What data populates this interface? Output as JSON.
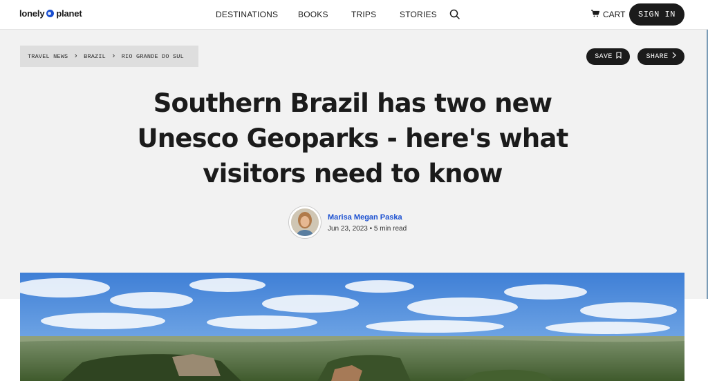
{
  "header": {
    "logo": {
      "left": "lonely",
      "right": "planet"
    },
    "nav": [
      "DESTINATIONS",
      "BOOKS",
      "TRIPS",
      "STORIES"
    ],
    "cart_label": "CART",
    "signin_label": "SIGN IN"
  },
  "breadcrumb": [
    "TRAVEL NEWS",
    "BRAZIL",
    "RIO GRANDE DO SUL"
  ],
  "actions": {
    "save_label": "SAVE",
    "share_label": "SHARE"
  },
  "article": {
    "title_lines": [
      "Southern Brazil has two new",
      "Unesco Geoparks - here's what",
      "visitors need to know"
    ],
    "author": "Marisa Megan Paska",
    "meta": "Jun 23, 2023 • 5 min read"
  },
  "colors": {
    "accent_link": "#1a4fd0",
    "dark_button": "#1b1b1b",
    "page_bg": "#f2f2f2"
  },
  "icons": [
    "globe-icon",
    "search-icon",
    "cart-icon",
    "chevron-right-icon",
    "bookmark-icon"
  ]
}
